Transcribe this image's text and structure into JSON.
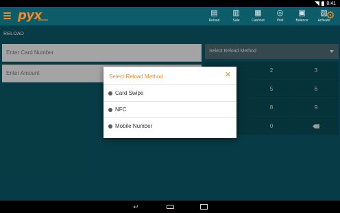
{
  "status_bar": {
    "time": "8:41"
  },
  "app_bar": {
    "logo": "pyx",
    "toolbar": [
      {
        "label": "Reload",
        "icon": "reload-icon"
      },
      {
        "label": "Sale",
        "icon": "sale-icon"
      },
      {
        "label": "Cashout",
        "icon": "cashout-icon"
      },
      {
        "label": "Void",
        "icon": "void-icon"
      },
      {
        "label": "Balance",
        "icon": "balance-icon"
      },
      {
        "label": "Activate",
        "icon": "activate-icon"
      }
    ],
    "settings_icon": "gear-icon"
  },
  "page": {
    "title": "RELOAD"
  },
  "form": {
    "card_number_placeholder": "Enter Card Number",
    "amount_placeholder": "Enter Amount",
    "method_select": "Select Reload Method"
  },
  "keypad": {
    "keys": [
      "2",
      "3",
      "5",
      "6",
      "8",
      "9",
      "0"
    ]
  },
  "dialog": {
    "title": "Select Reload Method",
    "options": [
      "Card Swipe",
      "NFC",
      "Mobile Number"
    ]
  },
  "colors": {
    "accent": "#f08a2b",
    "background": "#0b5866",
    "app_bar": "#0c5c6a",
    "select": "#4e6b73"
  }
}
